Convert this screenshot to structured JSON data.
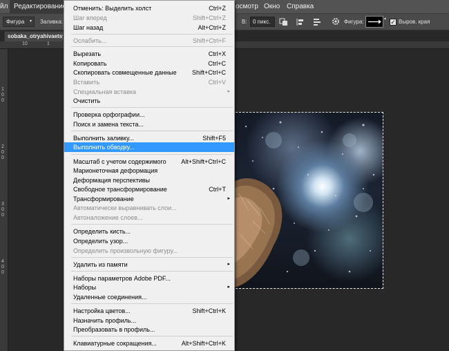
{
  "menubar": {
    "items": [
      "йл",
      "Редактирование",
      "осмотр",
      "Окно",
      "Справка"
    ]
  },
  "optionsbar": {
    "tool_mode": "Фигура",
    "fill_label": "Заливка:",
    "width_label": "В:",
    "width_value": "0 пикс.",
    "shape_label": "Фигура:",
    "align_edges_label": "Выров. края"
  },
  "document": {
    "tab_title": "sobaka_otryahivaetsy",
    "ruler_top": [
      "10",
      "1"
    ],
    "ruler_left": [
      "1",
      "0",
      "0",
      "2",
      "0",
      "0",
      "3",
      "0",
      "0",
      "4",
      "0",
      "0"
    ]
  },
  "edit_menu": {
    "items": [
      {
        "label": "Отменить: Выделить холст",
        "shortcut": "Ctrl+Z",
        "disabled": false
      },
      {
        "label": "Шаг вперед",
        "shortcut": "Shift+Ctrl+Z",
        "disabled": true
      },
      {
        "label": "Шаг назад",
        "shortcut": "Alt+Ctrl+Z",
        "disabled": false
      },
      {
        "label": "Ослабить...",
        "shortcut": "Shift+Ctrl+F",
        "disabled": true
      },
      {
        "label": "Вырезать",
        "shortcut": "Ctrl+X",
        "disabled": false
      },
      {
        "label": "Копировать",
        "shortcut": "Ctrl+C",
        "disabled": false
      },
      {
        "label": "Скопировать совмещенные данные",
        "shortcut": "Shift+Ctrl+C",
        "disabled": false
      },
      {
        "label": "Вставить",
        "shortcut": "Ctrl+V",
        "disabled": true
      },
      {
        "label": "Специальная вставка",
        "shortcut": "",
        "disabled": true
      },
      {
        "label": "Очистить",
        "shortcut": "",
        "disabled": false
      },
      {
        "label": "Проверка орфографии...",
        "shortcut": "",
        "disabled": false
      },
      {
        "label": "Поиск и замена текста...",
        "shortcut": "",
        "disabled": false
      },
      {
        "label": "Выполнить заливку...",
        "shortcut": "Shift+F5",
        "disabled": false
      },
      {
        "label": "Выполнить обводку...",
        "shortcut": "",
        "disabled": false,
        "highlighted": true
      },
      {
        "label": "Масштаб с учетом содержимого",
        "shortcut": "Alt+Shift+Ctrl+C",
        "disabled": false
      },
      {
        "label": "Марионеточная деформация",
        "shortcut": "",
        "disabled": false
      },
      {
        "label": "Деформация перспективы",
        "shortcut": "",
        "disabled": false
      },
      {
        "label": "Свободное трансформирование",
        "shortcut": "Ctrl+T",
        "disabled": false
      },
      {
        "label": "Трансформирование",
        "shortcut": "",
        "disabled": false
      },
      {
        "label": "Автоматически выравнивать слои...",
        "shortcut": "",
        "disabled": true
      },
      {
        "label": "Автоналожение слоев...",
        "shortcut": "",
        "disabled": true
      },
      {
        "label": "Определить кисть...",
        "shortcut": "",
        "disabled": false
      },
      {
        "label": "Определить узор...",
        "shortcut": "",
        "disabled": false
      },
      {
        "label": "Определить произвольную фигуру...",
        "shortcut": "",
        "disabled": true
      },
      {
        "label": "Удалить из памяти",
        "shortcut": "",
        "disabled": false
      },
      {
        "label": "Наборы параметров Adobe PDF...",
        "shortcut": "",
        "disabled": false
      },
      {
        "label": "Наборы",
        "shortcut": "",
        "disabled": false
      },
      {
        "label": "Удаленные соединения...",
        "shortcut": "",
        "disabled": false
      },
      {
        "label": "Настройка цветов...",
        "shortcut": "Shift+Ctrl+K",
        "disabled": false
      },
      {
        "label": "Назначить профиль...",
        "shortcut": "",
        "disabled": false
      },
      {
        "label": "Преобразовать в профиль...",
        "shortcut": "",
        "disabled": false
      },
      {
        "label": "Клавиатурные сокращения...",
        "shortcut": "Alt+Shift+Ctrl+K",
        "disabled": false
      }
    ],
    "submenu_arrow": "▸",
    "check_mark": "✓"
  },
  "colors": {
    "menu_bg": "#f0f0f0",
    "highlight": "#3399ff",
    "app_bg": "#282828",
    "menubar_bg": "#535353"
  }
}
